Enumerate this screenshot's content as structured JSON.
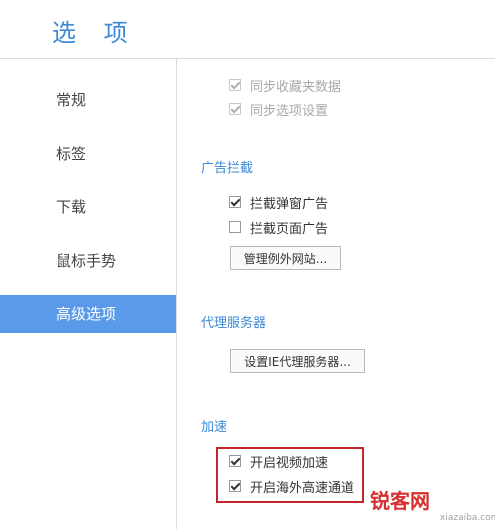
{
  "title": "选 项",
  "sidebar": {
    "items": [
      {
        "label": "常规"
      },
      {
        "label": "标签"
      },
      {
        "label": "下载"
      },
      {
        "label": "鼠标手势"
      },
      {
        "label": "高级选项"
      }
    ]
  },
  "sync": {
    "favorites": {
      "label": "同步收藏夹数据",
      "checked": true,
      "disabled": true
    },
    "settings": {
      "label": "同步选项设置",
      "checked": true,
      "disabled": true
    }
  },
  "adblock": {
    "title": "广告拦截",
    "popup": {
      "label": "拦截弹窗广告",
      "checked": true
    },
    "page": {
      "label": "拦截页面广告",
      "checked": false
    },
    "manage_button": "管理例外网站..."
  },
  "proxy": {
    "title": "代理服务器",
    "button": "设置IE代理服务器..."
  },
  "accelerate": {
    "title": "加速",
    "video": {
      "label": "开启视频加速",
      "checked": true
    },
    "overseas": {
      "label": "开启海外高速通道",
      "checked": true
    }
  },
  "watermark": {
    "text": "锐客网",
    "url": "xiazaiba.com"
  }
}
